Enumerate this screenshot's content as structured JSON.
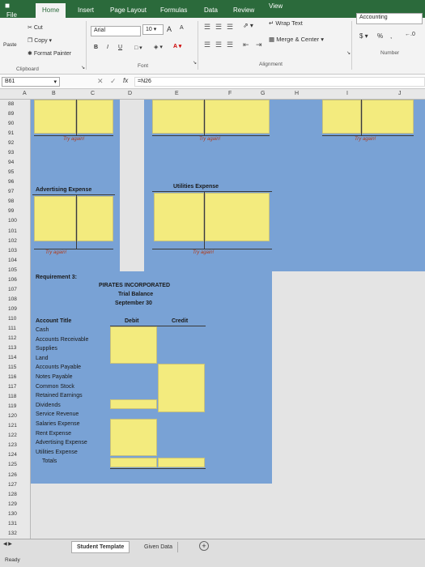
{
  "tabs": [
    "File",
    "Home",
    "Insert",
    "Page Layout",
    "Formulas",
    "Data",
    "Review",
    "View"
  ],
  "clipboard": {
    "cut": "Cut",
    "copy": "Copy",
    "paste": "Paste",
    "format_painter": "Format Painter",
    "label": "Clipboard"
  },
  "font": {
    "name": "Arial",
    "size": "10",
    "bold": "B",
    "italic": "I",
    "underline": "U",
    "grow": "A",
    "shrink": "A",
    "label": "Font"
  },
  "alignment": {
    "wrap": "Wrap Text",
    "merge": "Merge & Center",
    "label": "Alignment"
  },
  "number": {
    "format": "Accounting",
    "currency": "$",
    "percent": "%",
    "comma": ",",
    "label": "Number"
  },
  "formula_bar": {
    "name_box": "B61",
    "fx": "fx",
    "formula": "=N26"
  },
  "columns": [
    "A",
    "B",
    "C",
    "D",
    "E",
    "F",
    "G",
    "H",
    "I",
    "J"
  ],
  "rows": [
    "88",
    "89",
    "90",
    "91",
    "92",
    "93",
    "94",
    "95",
    "96",
    "97",
    "98",
    "99",
    "100",
    "101",
    "102",
    "103",
    "104",
    "105",
    "106",
    "107",
    "108",
    "109",
    "110",
    "111",
    "112",
    "113",
    "114",
    "115",
    "116",
    "117",
    "118",
    "119",
    "120",
    "121",
    "122",
    "123",
    "124",
    "125",
    "126",
    "127",
    "128",
    "129",
    "130",
    "131",
    "132"
  ],
  "t_accounts": {
    "try_again": "Try again!",
    "advertising": "Advertising Expense",
    "utilities": "Utilities Expense"
  },
  "trial_balance": {
    "requirement": "Requirement 3:",
    "company": "PIRATES INCORPORATED",
    "title": "Trial Balance",
    "date": "September 30",
    "col_account": "Account Title",
    "col_debit": "Debit",
    "col_credit": "Credit",
    "accounts": [
      "Cash",
      "Accounts Receivable",
      "Supplies",
      "Land",
      "Accounts Payable",
      "Notes Payable",
      "Common Stock",
      "Retained Earnings",
      "Dividends",
      "Service Revenue",
      "Salaries Expense",
      "Rent Expense",
      "Advertising Expense",
      "Utilities Expense"
    ],
    "totals": "Totals"
  },
  "sheets": [
    "Student Template",
    "Given Data"
  ],
  "add_sheet": "+",
  "status": "Ready",
  "colors": {
    "ribbon_green": "#2b6a3b",
    "cell_blue": "#79a2d5",
    "cell_yellow": "#f3eb7e"
  }
}
